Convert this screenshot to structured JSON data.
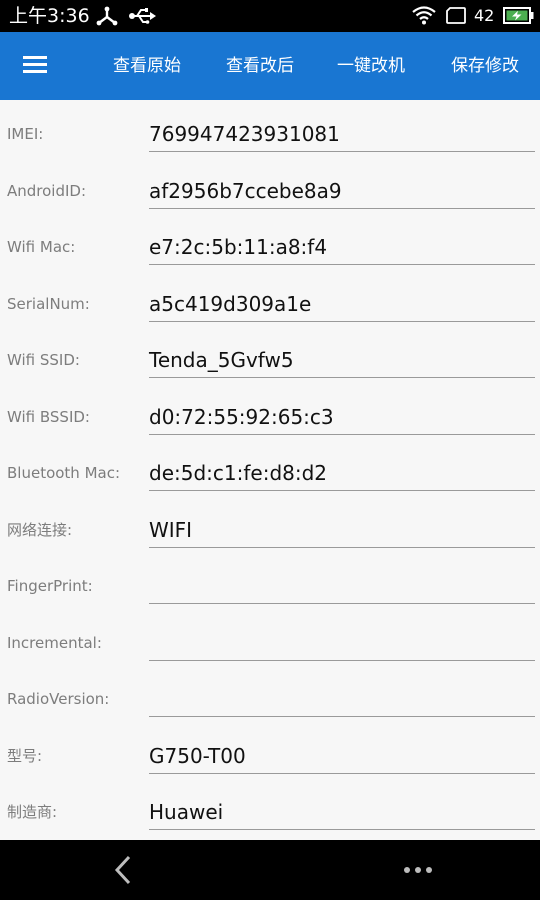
{
  "status_bar": {
    "time": "上午3:36",
    "signal_level": "42",
    "icons": [
      "usb-debug-icon",
      "usb-icon",
      "wifi-icon",
      "phone-icon",
      "battery-charging-icon"
    ]
  },
  "toolbar": {
    "background": "#1976d2",
    "menu_icon": "hamburger-menu-icon",
    "actions": [
      {
        "label": "查看原始"
      },
      {
        "label": "查看改后"
      },
      {
        "label": "一键改机"
      },
      {
        "label": "保存修改"
      }
    ]
  },
  "fields": [
    {
      "label": "IMEI:",
      "value": "769947423931081"
    },
    {
      "label": "AndroidID:",
      "value": "af2956b7ccebe8a9"
    },
    {
      "label": "Wifi Mac:",
      "value": "e7:2c:5b:11:a8:f4"
    },
    {
      "label": "SerialNum:",
      "value": "a5c419d309a1e"
    },
    {
      "label": "Wifi SSID:",
      "value": "Tenda_5Gvfw5"
    },
    {
      "label": "Wifi BSSID:",
      "value": "d0:72:55:92:65:c3"
    },
    {
      "label": "Bluetooth Mac:",
      "value": "de:5d:c1:fe:d8:d2"
    },
    {
      "label": "网络连接:",
      "value": "WIFI"
    },
    {
      "label": "FingerPrint:",
      "value": ""
    },
    {
      "label": "Incremental:",
      "value": ""
    },
    {
      "label": "RadioVersion:",
      "value": ""
    },
    {
      "label": "型号:",
      "value": "G750-T00"
    },
    {
      "label": "制造商:",
      "value": "Huawei"
    }
  ],
  "nav_bar": {
    "icons": [
      "back-icon",
      "more-icon"
    ]
  }
}
